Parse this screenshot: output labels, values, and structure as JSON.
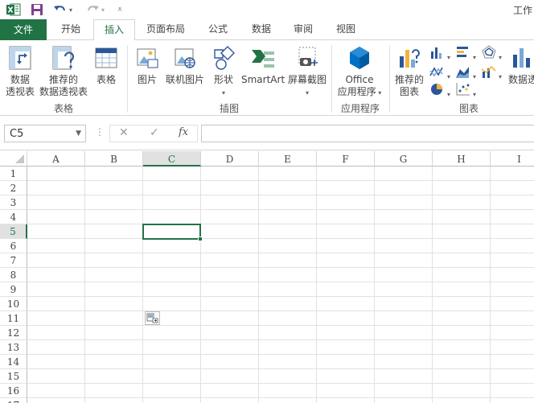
{
  "title": "工作",
  "quick_access": {
    "app_icon": "excel-icon",
    "save_icon": "save-icon",
    "undo_icon": "undo-icon",
    "redo_icon": "redo-icon",
    "customize_icon": "customize-icon"
  },
  "tabs": {
    "file": "文件",
    "home": "开始",
    "insert": "插入",
    "page_layout": "页面布局",
    "formulas": "公式",
    "data": "数据",
    "review": "审阅",
    "view": "视图"
  },
  "ribbon": {
    "tables": {
      "label": "表格",
      "pivot_line1": "数据",
      "pivot_line2": "透视表",
      "rec_pivot_line1": "推荐的",
      "rec_pivot_line2": "数据透视表",
      "table": "表格"
    },
    "illustrations": {
      "label": "插图",
      "pictures": "图片",
      "online_pictures": "联机图片",
      "shapes": "形状",
      "smartart": "SmartArt",
      "screenshot": "屏幕截图"
    },
    "apps": {
      "label": "应用程序",
      "office_line1": "Office",
      "office_line2": "应用程序"
    },
    "charts": {
      "label": "图表",
      "rec_chart_line1": "推荐的",
      "rec_chart_line2": "图表",
      "pivot_chart": "数据透"
    }
  },
  "formula_bar": {
    "name_box": "C5",
    "formula": ""
  },
  "grid": {
    "columns": [
      "A",
      "B",
      "C",
      "D",
      "E",
      "F",
      "G",
      "H",
      "I"
    ],
    "rows": [
      "1",
      "2",
      "3",
      "4",
      "5",
      "6",
      "7",
      "8",
      "9",
      "10",
      "11",
      "12",
      "13",
      "14",
      "15",
      "16",
      "17"
    ],
    "selected_column": "C",
    "selected_row": "5"
  },
  "colors": {
    "accent": "#217346",
    "header_selected": "#e1e1e1",
    "gridline": "#e1e1e1"
  }
}
